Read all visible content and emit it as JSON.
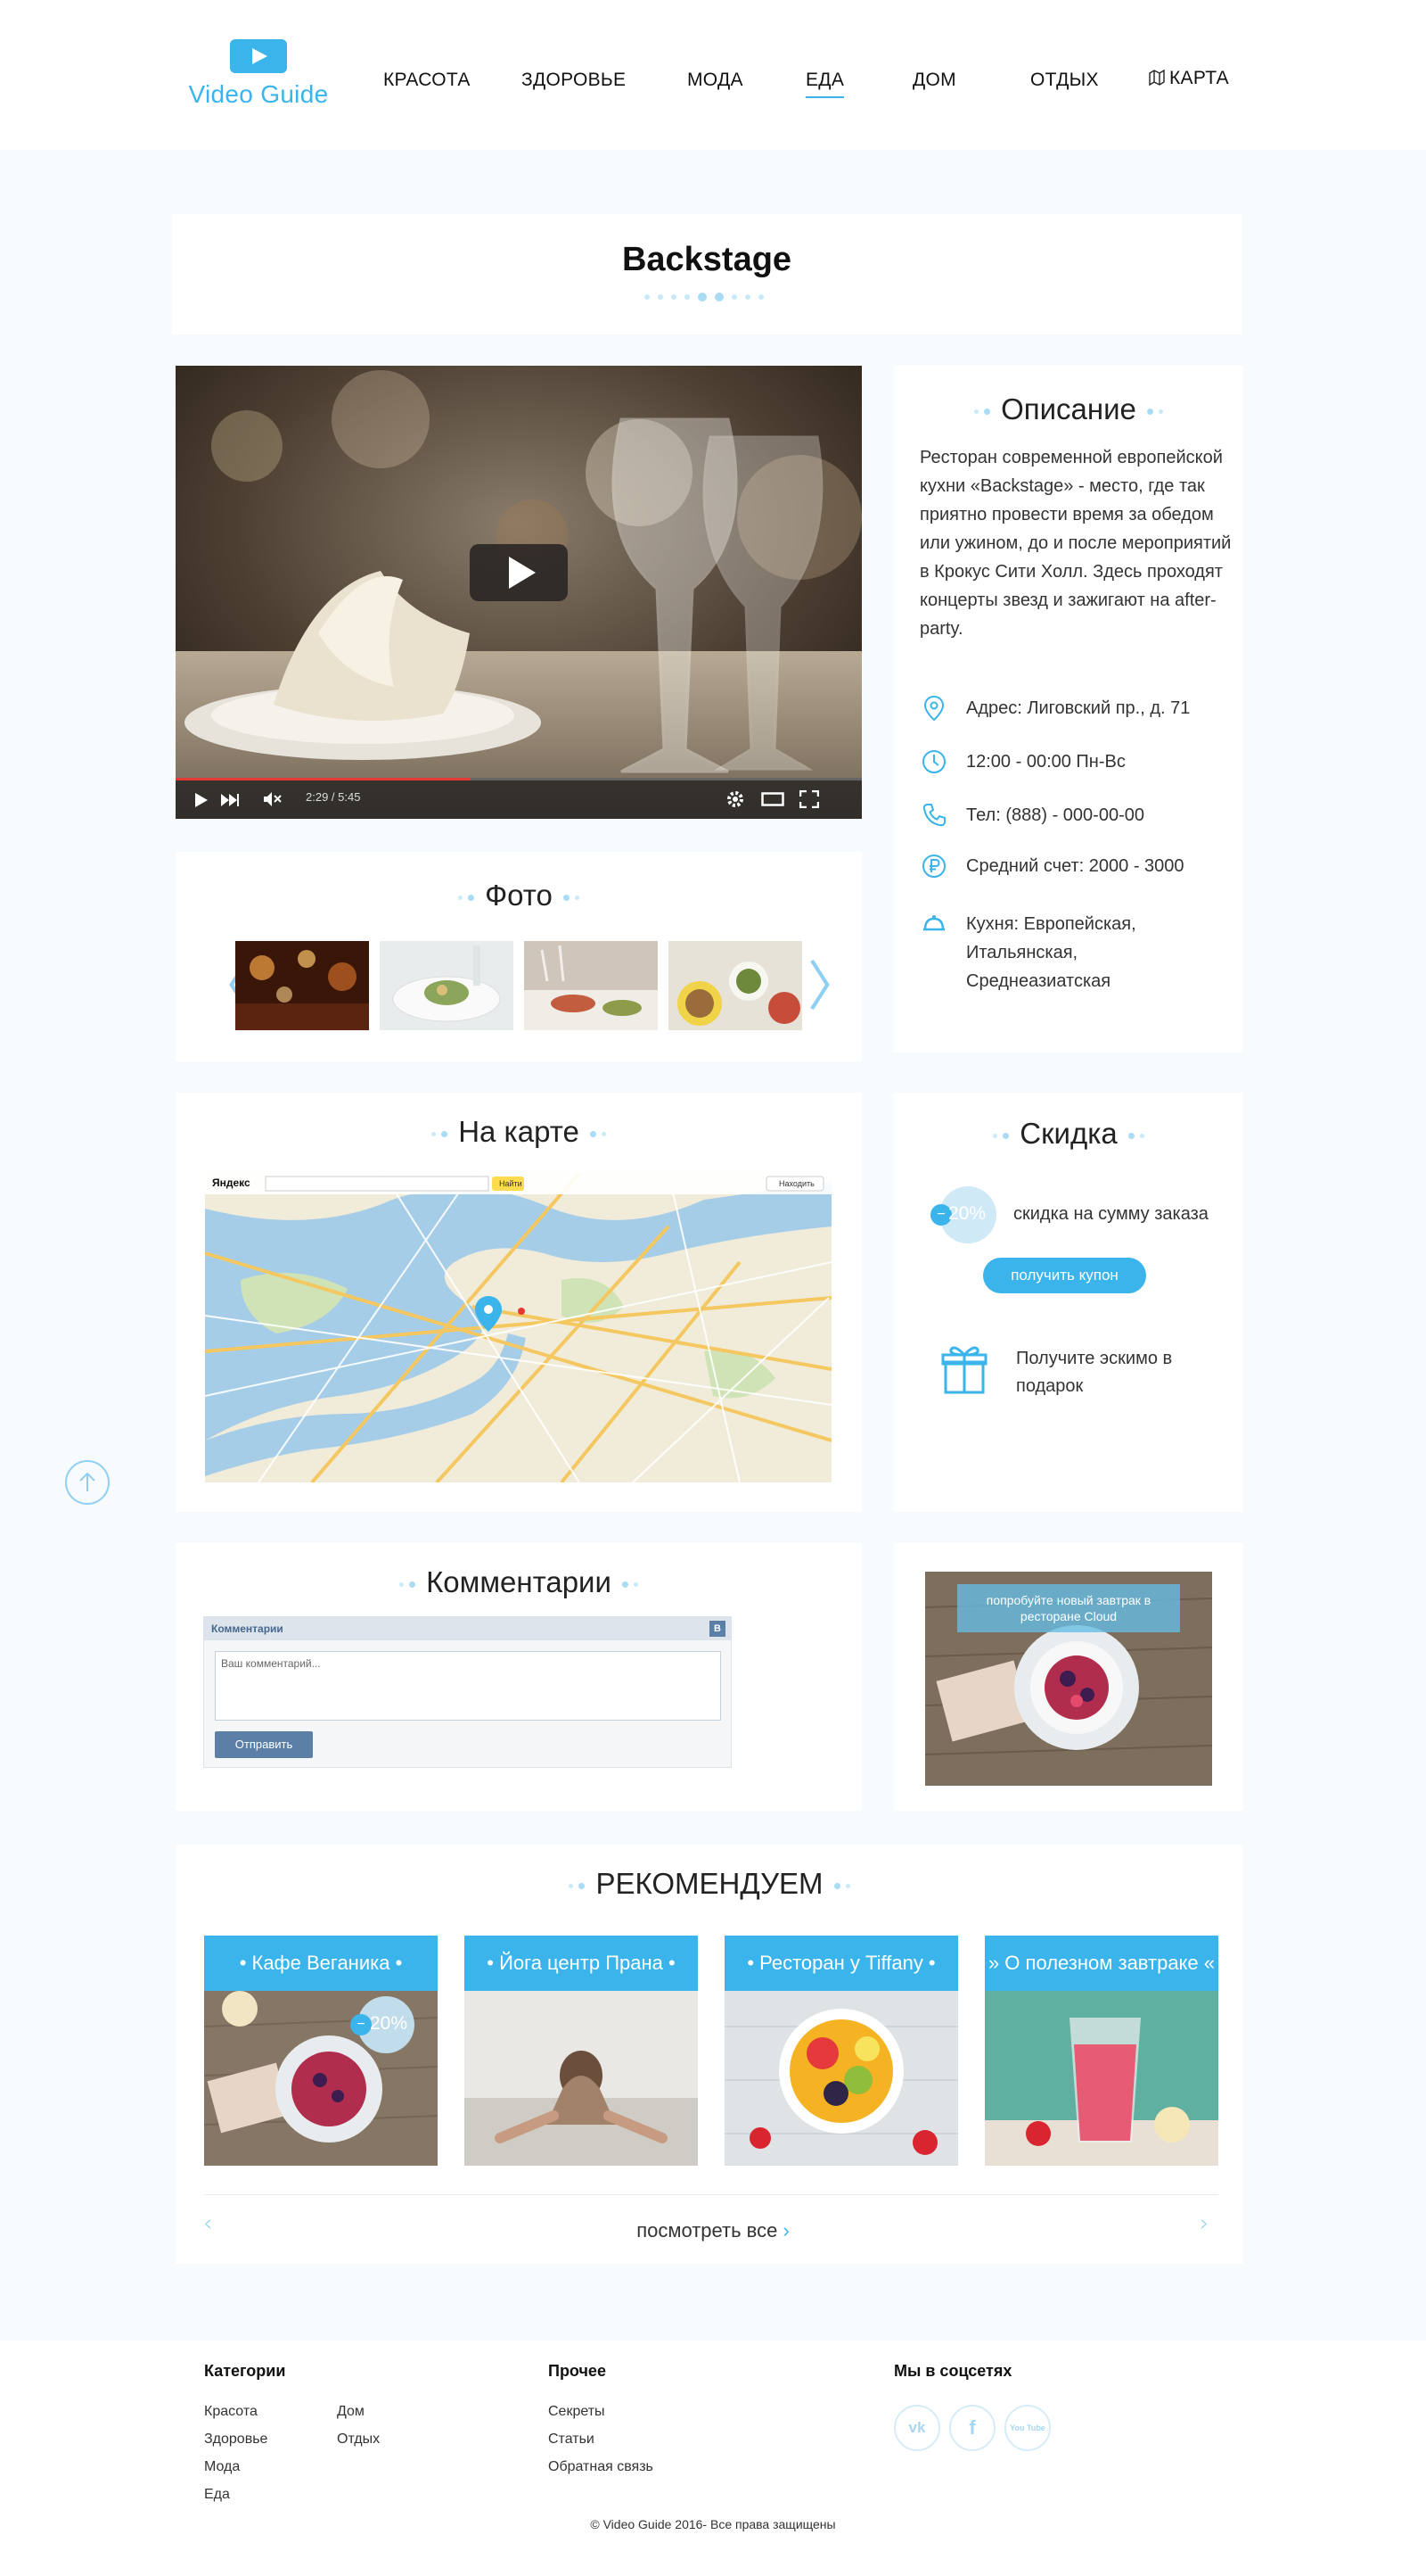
{
  "header": {
    "logo_text": "Video Guide",
    "nav": [
      "КРАСОТА",
      "ЗДОРОВЬЕ",
      "МОДА",
      "ЕДА",
      "ДОМ",
      "ОТДЫХ",
      "КАРТА"
    ],
    "active": "ЕДА"
  },
  "page": {
    "title": "Backstage"
  },
  "video": {
    "time": "2:29 / 5:45",
    "progress": 0.43
  },
  "description": {
    "title": "Описание",
    "text": "Ресторан современной европейской кухни «Backstage» - место, где так приятно провести время за обедом или ужином, до и после мероприятий в Крокус Сити Холл. Здесь проходят концерты звезд и зажигают на after-party.",
    "address": "Адрес: Лиговский пр., д. 71",
    "hours": "12:00 - 00:00   Пн-Вс",
    "phone": "Тел: (888) - 000-00-00",
    "avg_check": "Средний счет: 2000 - 3000",
    "cuisine": "Кухня: Европейская, Итальянская, Среднеазиатская"
  },
  "photos": {
    "title": "Фото"
  },
  "map": {
    "title": "На карте",
    "brand": "Яндекс",
    "find_btn": "Найти",
    "cities_btn": "Находить"
  },
  "discount": {
    "title": "Скидка",
    "badge": "20%",
    "minus": "−",
    "text": "скидка на сумму заказа",
    "button": "получить купон",
    "gift_text": "Получите эскимо в подарок"
  },
  "comments": {
    "title": "Комментарии",
    "widget_title": "Комментарии",
    "vk_letter": "B",
    "placeholder": "Ваш комментарий...",
    "submit": "Отправить"
  },
  "promo": {
    "text": "попробуйте новый завтрак в ресторане Cloud"
  },
  "recommend": {
    "title": "РЕКОМЕНДУЕМ",
    "cards": [
      {
        "label": "•  Кафе Веганика  •",
        "badge": "20%",
        "minus": "−"
      },
      {
        "label": "•  Йога центр Прана  •"
      },
      {
        "label": "•  Ресторан у Tiffany  •"
      },
      {
        "label": "»  О полезном завтраке  «"
      }
    ],
    "view_all": "посмотреть все"
  },
  "footer": {
    "categories_title": "Категории",
    "categories_col1": [
      "Красота",
      "Здоровье",
      "Мода",
      "Еда"
    ],
    "categories_col2": [
      "Дом",
      "Отдых"
    ],
    "other_title": "Прочее",
    "other": [
      "Секреты",
      "Статьи",
      "Обратная связь"
    ],
    "social_title": "Мы в соцсетях",
    "social": [
      "vk",
      "f",
      "You Tube"
    ],
    "copyright": "© Video Guide  2016- Все права защищены"
  },
  "colors": {
    "accent": "#3ab4ea",
    "page_bg": "#f8fbfd"
  }
}
